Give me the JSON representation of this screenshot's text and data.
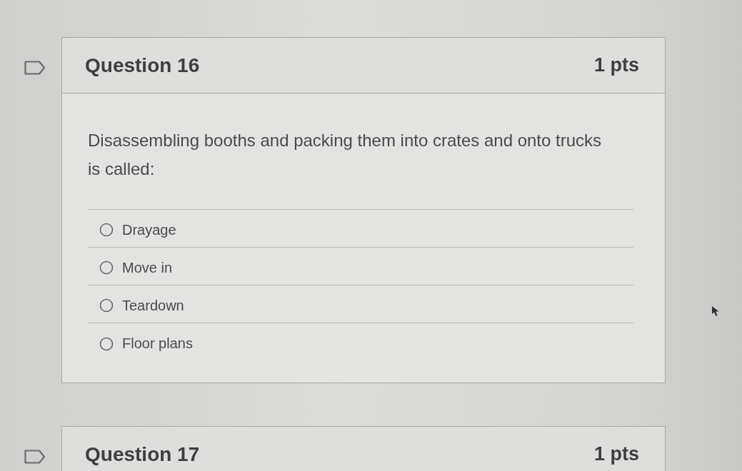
{
  "questions": [
    {
      "title": "Question 16",
      "points": "1 pts",
      "flagged": false,
      "text": "Disassembling booths and packing them into crates and onto trucks is called:",
      "answers": [
        {
          "label": "Drayage",
          "selected": false
        },
        {
          "label": "Move in",
          "selected": false
        },
        {
          "label": "Teardown",
          "selected": false
        },
        {
          "label": "Floor plans",
          "selected": false
        }
      ]
    },
    {
      "title": "Question 17",
      "points": "1 pts",
      "flagged": false
    }
  ]
}
